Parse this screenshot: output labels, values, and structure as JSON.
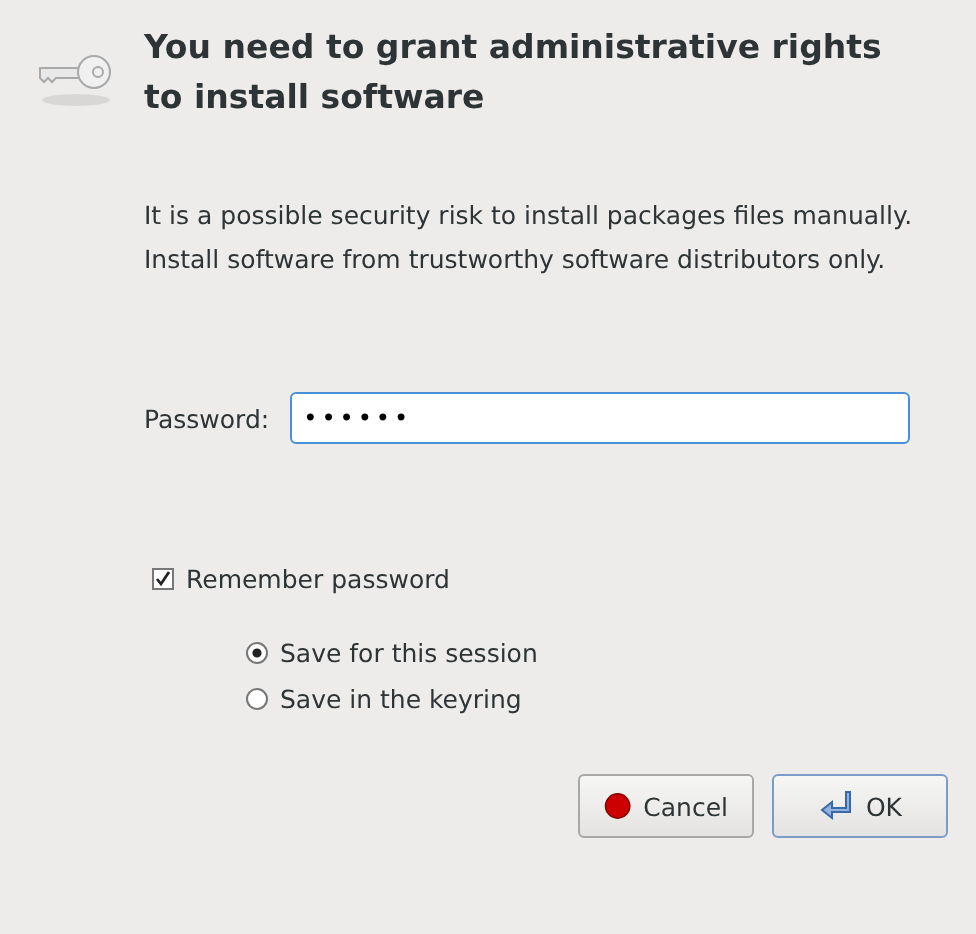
{
  "title": "You need to grant administrative rights to install software",
  "message": "It is a possible security risk to install packages files manually. Install software from trustworthy software distributors only.",
  "password": {
    "label": "Password:",
    "value": "••••••"
  },
  "remember": {
    "label": "Remember password",
    "checked": true
  },
  "save_options": [
    {
      "label": "Save for this session",
      "selected": true
    },
    {
      "label": "Save in the keyring",
      "selected": false
    }
  ],
  "buttons": [
    {
      "label": "Cancel",
      "kind": "cancel"
    },
    {
      "label": "OK",
      "kind": "ok"
    }
  ]
}
